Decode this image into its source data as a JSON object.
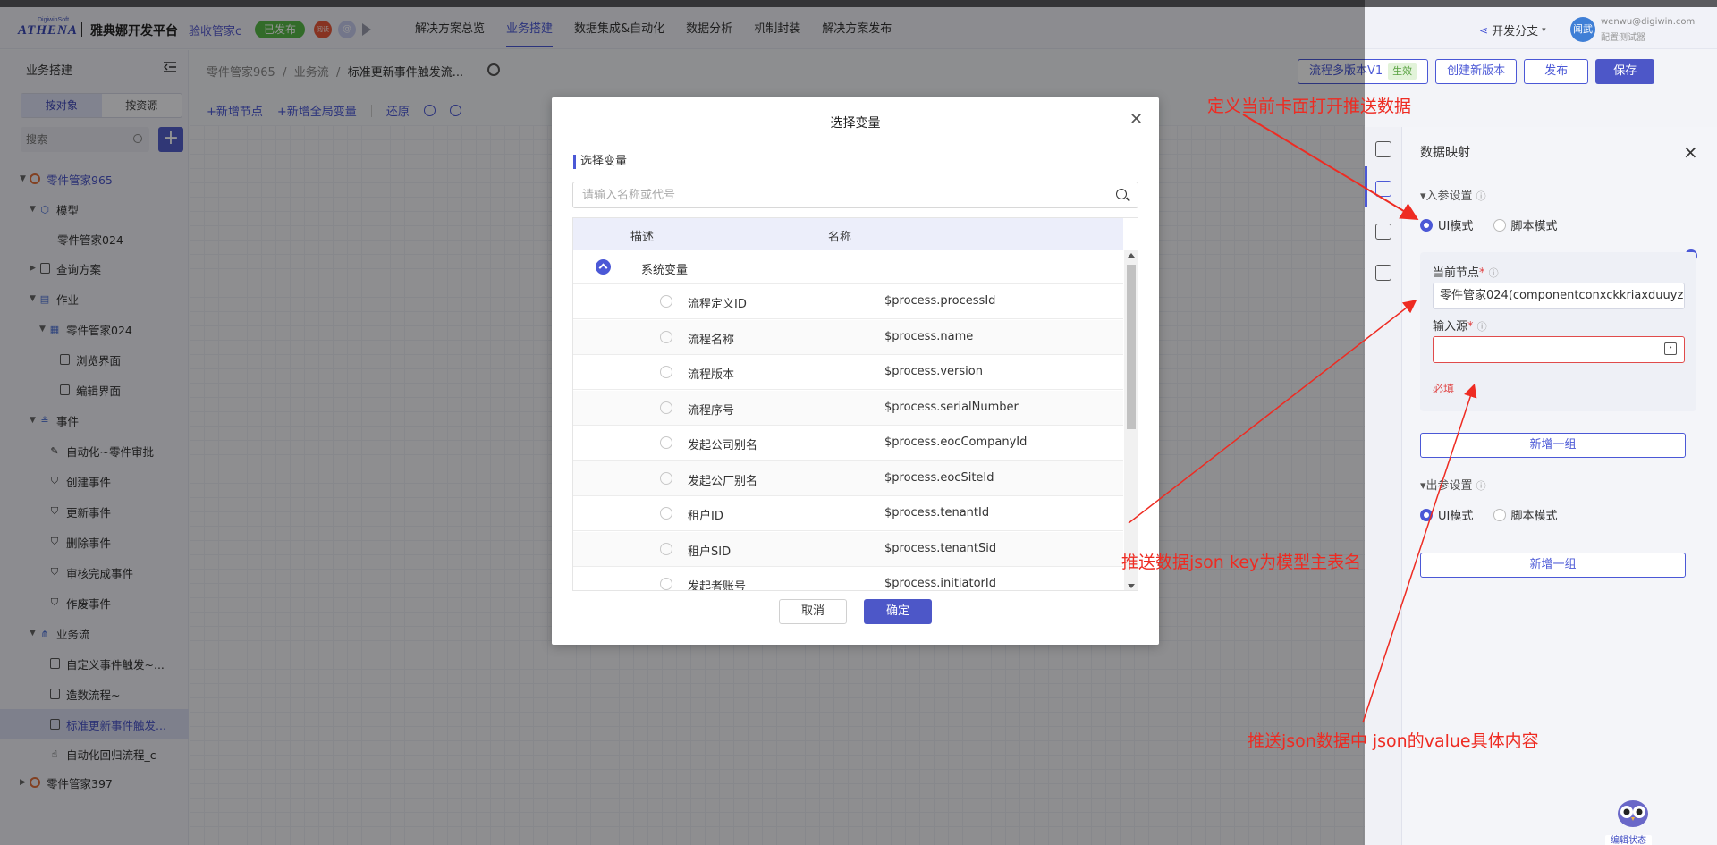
{
  "topbar": {
    "logo_sub": "DigiwinSoft",
    "logo_main": "ATHENA",
    "brand": "雅典娜开发平台",
    "app_name": "验收管家c",
    "status_badge": "已发布",
    "avatar_red": "阅读",
    "avatar_lav": "@",
    "nav": [
      "解决方案总览",
      "业务搭建",
      "数据集成&自动化",
      "数据分析",
      "机制封装",
      "解决方案发布"
    ],
    "nav_active": "业务搭建",
    "share": "开发分支",
    "user_avatar": "闻武",
    "user_email": "wenwu@digiwin.com",
    "user_role": "配置测试器"
  },
  "sidebar": {
    "title": "业务搭建",
    "tabs": [
      "按对象",
      "按资源"
    ],
    "active_tab": "按对象",
    "search_placeholder": "搜索",
    "tree": [
      {
        "label": "零件管家965",
        "level": 0,
        "caret": "▼",
        "icon": "orange-circle-icon",
        "blue": true
      },
      {
        "label": "模型",
        "level": 1,
        "caret": "▼",
        "icon": "cube-icon"
      },
      {
        "label": "零件管家024",
        "level": 2,
        "caret": "",
        "icon": ""
      },
      {
        "label": "查询方案",
        "level": 1,
        "caret": "▶",
        "icon": "query-icon"
      },
      {
        "label": "作业",
        "level": 1,
        "caret": "▼",
        "icon": "job-icon"
      },
      {
        "label": "零件管家024",
        "level": 2,
        "caret": "▼",
        "icon": "job-item-icon"
      },
      {
        "label": "浏览界面",
        "level": 3,
        "caret": "",
        "icon": "browse-icon"
      },
      {
        "label": "编辑界面",
        "level": 3,
        "caret": "",
        "icon": "edit-icon"
      },
      {
        "label": "事件",
        "level": 1,
        "caret": "▼",
        "icon": "event-icon"
      },
      {
        "label": "自动化~零件审批",
        "level": 2,
        "caret": "",
        "icon": "pen-icon"
      },
      {
        "label": "创建事件",
        "level": 2,
        "caret": "",
        "icon": "shield-check-icon"
      },
      {
        "label": "更新事件",
        "level": 2,
        "caret": "",
        "icon": "shield-check-icon"
      },
      {
        "label": "删除事件",
        "level": 2,
        "caret": "",
        "icon": "shield-check-icon"
      },
      {
        "label": "审核完成事件",
        "level": 2,
        "caret": "",
        "icon": "shield-check-icon"
      },
      {
        "label": "作废事件",
        "level": 2,
        "caret": "",
        "icon": "shield-check-icon"
      },
      {
        "label": "业务流",
        "level": 1,
        "caret": "▼",
        "icon": "flow-icon"
      },
      {
        "label": "自定义事件触发~...",
        "level": 2,
        "caret": "",
        "icon": "doc-icon"
      },
      {
        "label": "造数流程~",
        "level": 2,
        "caret": "",
        "icon": "camera-icon"
      },
      {
        "label": "标准更新事件触发...",
        "level": 2,
        "caret": "",
        "icon": "doc-icon",
        "selected": true
      },
      {
        "label": "自动化回归流程_c",
        "level": 2,
        "caret": "",
        "icon": "hand-icon"
      },
      {
        "label": "零件管家397",
        "level": 0,
        "caret": "▶",
        "icon": "orange-circle-icon"
      }
    ]
  },
  "header": {
    "crumb1": "零件管家965",
    "crumb2": "业务流",
    "crumb3": "标准更新事件触发流...",
    "toolbar": [
      "+新增节点",
      "+新增全局变量",
      "还原"
    ],
    "version_btn": "流程多版本V1",
    "version_tag": "生效",
    "new_version": "创建新版本",
    "publish": "发布",
    "save": "保存"
  },
  "panel": {
    "title": "数据映射",
    "in_section": "▾入参设置",
    "out_section": "▾出参设置",
    "mode_ui": "UI模式",
    "mode_script": "脚本模式",
    "current_node_label": "当前节点",
    "current_node_value": "零件管家024(componentconxckkriaxduuyz",
    "input_source_label": "输入源",
    "required": "必填",
    "add_group": "新增一组"
  },
  "modal": {
    "title": "选择变量",
    "sub": "选择变量",
    "search_placeholder": "请输入名称或代号",
    "col_desc": "描述",
    "col_name": "名称",
    "group": "系统变量",
    "rows": [
      {
        "desc": "流程定义ID",
        "name": "$process.processId"
      },
      {
        "desc": "流程名称",
        "name": "$process.name"
      },
      {
        "desc": "流程版本",
        "name": "$process.version"
      },
      {
        "desc": "流程序号",
        "name": "$process.serialNumber"
      },
      {
        "desc": "发起公司别名",
        "name": "$process.eocCompanyId"
      },
      {
        "desc": "发起公厂别名",
        "name": "$process.eocSiteId"
      },
      {
        "desc": "租户ID",
        "name": "$process.tenantId"
      },
      {
        "desc": "租户SID",
        "name": "$process.tenantSid"
      },
      {
        "desc": "发起者账号",
        "name": "$process.initiatorId"
      }
    ],
    "cancel": "取消",
    "ok": "确定"
  },
  "annotations": {
    "a1": "定义当前卡面打开推送数据",
    "a2": "推送数据json key为模型主表名",
    "a3": "推送json数据中 json的value具体内容"
  },
  "assistant_badge": "编辑状态",
  "colors": {
    "accent": "#4b58d6",
    "annotation": "#ee2b22",
    "published": "#56b947"
  }
}
